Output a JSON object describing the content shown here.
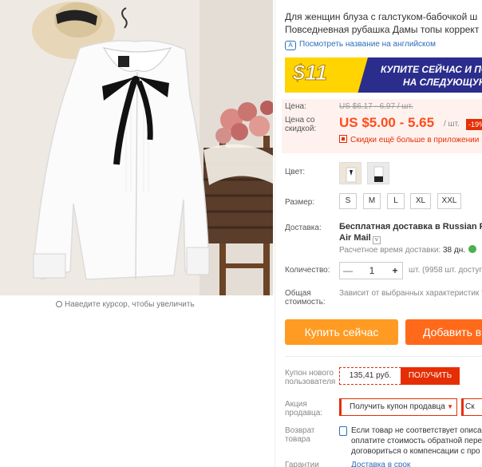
{
  "product": {
    "title_line1": "Для женщин блуза с галстуком-бабочкой ш",
    "title_line2": "Повседневная рубашка Дамы топы коррект",
    "translate_link": "Посмотреть название на английском",
    "zoom_hint": "Наведите курсор, чтобы увеличить"
  },
  "banner": {
    "amount": "$11",
    "line1": "КУПИТЕ СЕЙЧАС И ПОЛ",
    "line2": "НА СЛЕДУЮЩУЮ"
  },
  "price": {
    "label": "Цена:",
    "old": "US $6.17 - 6.97 / шт.",
    "discount_label_1": "Цена со",
    "discount_label_2": "скидкой:",
    "current": "US $5.00 - 5.65",
    "unit": "/ шт.",
    "discount_badge": "-19%",
    "app_discount": "Скидки ещё больше в приложении"
  },
  "options": {
    "color_label": "Цвет:",
    "size_label": "Размер:",
    "sizes": [
      "S",
      "M",
      "L",
      "XL",
      "XXL"
    ]
  },
  "shipping": {
    "label": "Доставка:",
    "line1": "Бесплатная доставка в Russian Feder",
    "line2": "Air Mail",
    "time_label": "Расчетное время доставки:",
    "time_value": "38 дн."
  },
  "quantity": {
    "label": "Количество:",
    "minus": "—",
    "value": "1",
    "plus": "+",
    "available": "шт. (9958 шт. доступ"
  },
  "total": {
    "label_1": "Общая",
    "label_2": "стоимость:",
    "text": "Зависит от выбранных характеристик т"
  },
  "buttons": {
    "buy_now": "Купить сейчас",
    "add_to_cart": "Добавить в"
  },
  "coupon": {
    "label_1": "Купон нового",
    "label_2": "пользователя",
    "value": "135,41 руб.",
    "get": "ПОЛУЧИТЬ"
  },
  "seller": {
    "label_1": "Акция",
    "label_2": "продавца:",
    "select": "Получить купон продавца",
    "select2": "Ск"
  },
  "returns": {
    "label_1": "Возврат",
    "label_2": "товара",
    "line1": "Если товар не соответствует описан",
    "line2": "оплатите стоимость обратной перес",
    "line3": "договориться о компенсации с про"
  },
  "guarantee": {
    "label": "Гарантии",
    "text": "Доставка в срок"
  },
  "colors": {
    "accent": "#ff4c1b",
    "buy": "#ff9b22",
    "cart": "#ff6a1a",
    "link": "#2a6ebb"
  }
}
